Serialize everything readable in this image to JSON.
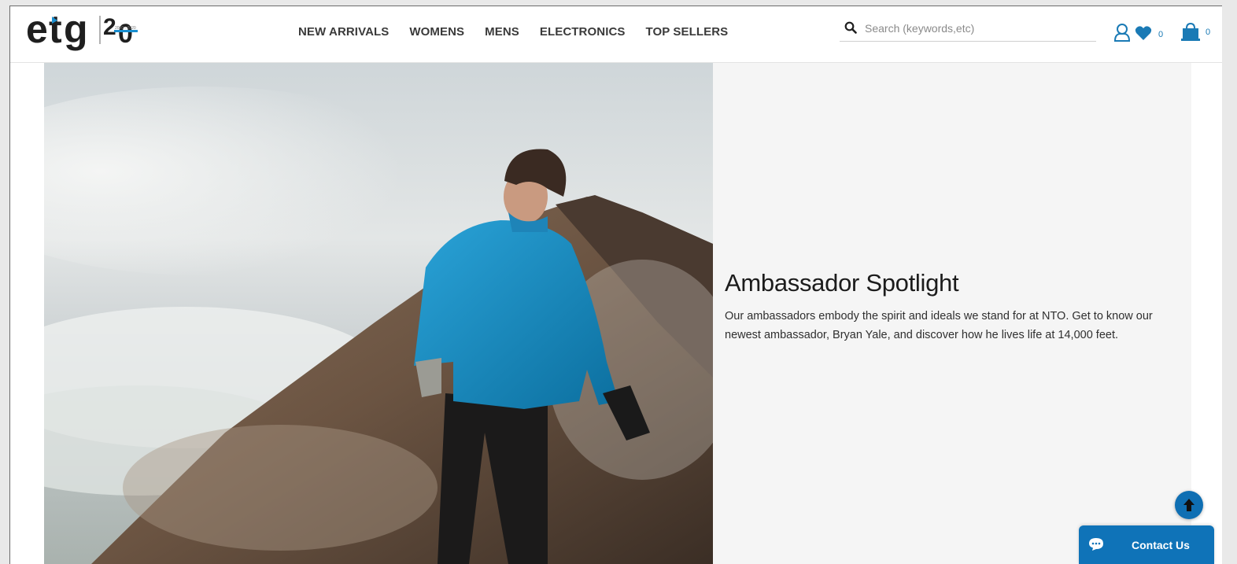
{
  "brand": {
    "logo_main": "etg",
    "logo_number": "20",
    "logo_small": "2000 - 2020"
  },
  "nav": {
    "items": [
      "NEW ARRIVALS",
      "WOMENS",
      "MENS",
      "ELECTRONICS",
      "TOP SELLERS"
    ]
  },
  "search": {
    "placeholder": "Search (keywords,etc)",
    "value": ""
  },
  "header_icons": {
    "account": "user-icon",
    "wishlist": {
      "icon": "heart-icon",
      "count": "0"
    },
    "cart": {
      "icon": "shopping-bag-icon",
      "count": "0"
    }
  },
  "spotlight": {
    "title": "Ambassador Spotlight",
    "description": "Our ambassadors embody the spirit and ideals we stand for at NTO. Get to know our newest ambassador, Bryan Yale, and discover how he lives life at 14,000 feet."
  },
  "floating": {
    "back_to_top": "arrow-up-icon",
    "contact_label": "Contact Us",
    "contact_icon": "chat-icon"
  },
  "colors": {
    "accent": "#0f73b8",
    "logo_dark": "#1f1f1f",
    "heading": "#1c1c1c",
    "panel_bg": "#f5f5f5"
  }
}
